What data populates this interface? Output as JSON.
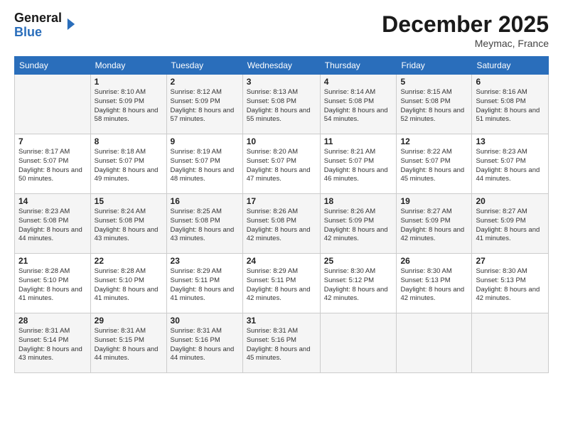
{
  "header": {
    "logo_line1": "General",
    "logo_line2": "Blue",
    "month": "December 2025",
    "location": "Meymac, France"
  },
  "weekdays": [
    "Sunday",
    "Monday",
    "Tuesday",
    "Wednesday",
    "Thursday",
    "Friday",
    "Saturday"
  ],
  "weeks": [
    [
      {
        "day": "",
        "sunrise": "",
        "sunset": "",
        "daylight": ""
      },
      {
        "day": "1",
        "sunrise": "Sunrise: 8:10 AM",
        "sunset": "Sunset: 5:09 PM",
        "daylight": "Daylight: 8 hours and 58 minutes."
      },
      {
        "day": "2",
        "sunrise": "Sunrise: 8:12 AM",
        "sunset": "Sunset: 5:09 PM",
        "daylight": "Daylight: 8 hours and 57 minutes."
      },
      {
        "day": "3",
        "sunrise": "Sunrise: 8:13 AM",
        "sunset": "Sunset: 5:08 PM",
        "daylight": "Daylight: 8 hours and 55 minutes."
      },
      {
        "day": "4",
        "sunrise": "Sunrise: 8:14 AM",
        "sunset": "Sunset: 5:08 PM",
        "daylight": "Daylight: 8 hours and 54 minutes."
      },
      {
        "day": "5",
        "sunrise": "Sunrise: 8:15 AM",
        "sunset": "Sunset: 5:08 PM",
        "daylight": "Daylight: 8 hours and 52 minutes."
      },
      {
        "day": "6",
        "sunrise": "Sunrise: 8:16 AM",
        "sunset": "Sunset: 5:08 PM",
        "daylight": "Daylight: 8 hours and 51 minutes."
      }
    ],
    [
      {
        "day": "7",
        "sunrise": "Sunrise: 8:17 AM",
        "sunset": "Sunset: 5:07 PM",
        "daylight": "Daylight: 8 hours and 50 minutes."
      },
      {
        "day": "8",
        "sunrise": "Sunrise: 8:18 AM",
        "sunset": "Sunset: 5:07 PM",
        "daylight": "Daylight: 8 hours and 49 minutes."
      },
      {
        "day": "9",
        "sunrise": "Sunrise: 8:19 AM",
        "sunset": "Sunset: 5:07 PM",
        "daylight": "Daylight: 8 hours and 48 minutes."
      },
      {
        "day": "10",
        "sunrise": "Sunrise: 8:20 AM",
        "sunset": "Sunset: 5:07 PM",
        "daylight": "Daylight: 8 hours and 47 minutes."
      },
      {
        "day": "11",
        "sunrise": "Sunrise: 8:21 AM",
        "sunset": "Sunset: 5:07 PM",
        "daylight": "Daylight: 8 hours and 46 minutes."
      },
      {
        "day": "12",
        "sunrise": "Sunrise: 8:22 AM",
        "sunset": "Sunset: 5:07 PM",
        "daylight": "Daylight: 8 hours and 45 minutes."
      },
      {
        "day": "13",
        "sunrise": "Sunrise: 8:23 AM",
        "sunset": "Sunset: 5:07 PM",
        "daylight": "Daylight: 8 hours and 44 minutes."
      }
    ],
    [
      {
        "day": "14",
        "sunrise": "Sunrise: 8:23 AM",
        "sunset": "Sunset: 5:08 PM",
        "daylight": "Daylight: 8 hours and 44 minutes."
      },
      {
        "day": "15",
        "sunrise": "Sunrise: 8:24 AM",
        "sunset": "Sunset: 5:08 PM",
        "daylight": "Daylight: 8 hours and 43 minutes."
      },
      {
        "day": "16",
        "sunrise": "Sunrise: 8:25 AM",
        "sunset": "Sunset: 5:08 PM",
        "daylight": "Daylight: 8 hours and 43 minutes."
      },
      {
        "day": "17",
        "sunrise": "Sunrise: 8:26 AM",
        "sunset": "Sunset: 5:08 PM",
        "daylight": "Daylight: 8 hours and 42 minutes."
      },
      {
        "day": "18",
        "sunrise": "Sunrise: 8:26 AM",
        "sunset": "Sunset: 5:09 PM",
        "daylight": "Daylight: 8 hours and 42 minutes."
      },
      {
        "day": "19",
        "sunrise": "Sunrise: 8:27 AM",
        "sunset": "Sunset: 5:09 PM",
        "daylight": "Daylight: 8 hours and 42 minutes."
      },
      {
        "day": "20",
        "sunrise": "Sunrise: 8:27 AM",
        "sunset": "Sunset: 5:09 PM",
        "daylight": "Daylight: 8 hours and 41 minutes."
      }
    ],
    [
      {
        "day": "21",
        "sunrise": "Sunrise: 8:28 AM",
        "sunset": "Sunset: 5:10 PM",
        "daylight": "Daylight: 8 hours and 41 minutes."
      },
      {
        "day": "22",
        "sunrise": "Sunrise: 8:28 AM",
        "sunset": "Sunset: 5:10 PM",
        "daylight": "Daylight: 8 hours and 41 minutes."
      },
      {
        "day": "23",
        "sunrise": "Sunrise: 8:29 AM",
        "sunset": "Sunset: 5:11 PM",
        "daylight": "Daylight: 8 hours and 41 minutes."
      },
      {
        "day": "24",
        "sunrise": "Sunrise: 8:29 AM",
        "sunset": "Sunset: 5:11 PM",
        "daylight": "Daylight: 8 hours and 42 minutes."
      },
      {
        "day": "25",
        "sunrise": "Sunrise: 8:30 AM",
        "sunset": "Sunset: 5:12 PM",
        "daylight": "Daylight: 8 hours and 42 minutes."
      },
      {
        "day": "26",
        "sunrise": "Sunrise: 8:30 AM",
        "sunset": "Sunset: 5:13 PM",
        "daylight": "Daylight: 8 hours and 42 minutes."
      },
      {
        "day": "27",
        "sunrise": "Sunrise: 8:30 AM",
        "sunset": "Sunset: 5:13 PM",
        "daylight": "Daylight: 8 hours and 42 minutes."
      }
    ],
    [
      {
        "day": "28",
        "sunrise": "Sunrise: 8:31 AM",
        "sunset": "Sunset: 5:14 PM",
        "daylight": "Daylight: 8 hours and 43 minutes."
      },
      {
        "day": "29",
        "sunrise": "Sunrise: 8:31 AM",
        "sunset": "Sunset: 5:15 PM",
        "daylight": "Daylight: 8 hours and 44 minutes."
      },
      {
        "day": "30",
        "sunrise": "Sunrise: 8:31 AM",
        "sunset": "Sunset: 5:16 PM",
        "daylight": "Daylight: 8 hours and 44 minutes."
      },
      {
        "day": "31",
        "sunrise": "Sunrise: 8:31 AM",
        "sunset": "Sunset: 5:16 PM",
        "daylight": "Daylight: 8 hours and 45 minutes."
      },
      {
        "day": "",
        "sunrise": "",
        "sunset": "",
        "daylight": ""
      },
      {
        "day": "",
        "sunrise": "",
        "sunset": "",
        "daylight": ""
      },
      {
        "day": "",
        "sunrise": "",
        "sunset": "",
        "daylight": ""
      }
    ]
  ]
}
